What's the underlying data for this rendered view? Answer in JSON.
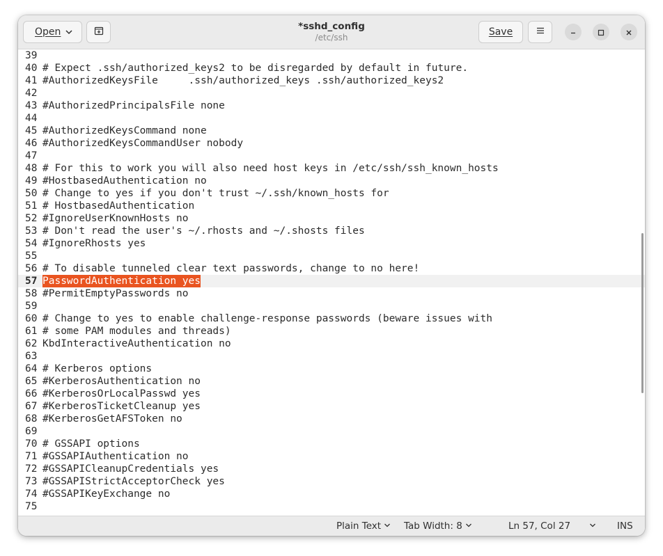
{
  "header": {
    "open_label": "Open",
    "save_label": "Save",
    "title": "*sshd_config",
    "subtitle": "/etc/ssh"
  },
  "editor": {
    "lines": [
      {
        "num": "39",
        "text": ""
      },
      {
        "num": "40",
        "text": "# Expect .ssh/authorized_keys2 to be disregarded by default in future."
      },
      {
        "num": "41",
        "text": "#AuthorizedKeysFile     .ssh/authorized_keys .ssh/authorized_keys2"
      },
      {
        "num": "42",
        "text": ""
      },
      {
        "num": "43",
        "text": "#AuthorizedPrincipalsFile none"
      },
      {
        "num": "44",
        "text": ""
      },
      {
        "num": "45",
        "text": "#AuthorizedKeysCommand none"
      },
      {
        "num": "46",
        "text": "#AuthorizedKeysCommandUser nobody"
      },
      {
        "num": "47",
        "text": ""
      },
      {
        "num": "48",
        "text": "# For this to work you will also need host keys in /etc/ssh/ssh_known_hosts"
      },
      {
        "num": "49",
        "text": "#HostbasedAuthentication no"
      },
      {
        "num": "50",
        "text": "# Change to yes if you don't trust ~/.ssh/known_hosts for"
      },
      {
        "num": "51",
        "text": "# HostbasedAuthentication"
      },
      {
        "num": "52",
        "text": "#IgnoreUserKnownHosts no"
      },
      {
        "num": "53",
        "text": "# Don't read the user's ~/.rhosts and ~/.shosts files"
      },
      {
        "num": "54",
        "text": "#IgnoreRhosts yes"
      },
      {
        "num": "55",
        "text": ""
      },
      {
        "num": "56",
        "text": "# To disable tunneled clear text passwords, change to no here!"
      },
      {
        "num": "57",
        "text": "PasswordAuthentication yes",
        "current": true,
        "selected": true
      },
      {
        "num": "58",
        "text": "#PermitEmptyPasswords no"
      },
      {
        "num": "59",
        "text": ""
      },
      {
        "num": "60",
        "text": "# Change to yes to enable challenge-response passwords (beware issues with"
      },
      {
        "num": "61",
        "text": "# some PAM modules and threads)"
      },
      {
        "num": "62",
        "text": "KbdInteractiveAuthentication no"
      },
      {
        "num": "63",
        "text": ""
      },
      {
        "num": "64",
        "text": "# Kerberos options"
      },
      {
        "num": "65",
        "text": "#KerberosAuthentication no"
      },
      {
        "num": "66",
        "text": "#KerberosOrLocalPasswd yes"
      },
      {
        "num": "67",
        "text": "#KerberosTicketCleanup yes"
      },
      {
        "num": "68",
        "text": "#KerberosGetAFSToken no"
      },
      {
        "num": "69",
        "text": ""
      },
      {
        "num": "70",
        "text": "# GSSAPI options"
      },
      {
        "num": "71",
        "text": "#GSSAPIAuthentication no"
      },
      {
        "num": "72",
        "text": "#GSSAPICleanupCredentials yes"
      },
      {
        "num": "73",
        "text": "#GSSAPIStrictAcceptorCheck yes"
      },
      {
        "num": "74",
        "text": "#GSSAPIKeyExchange no"
      },
      {
        "num": "75",
        "text": ""
      }
    ]
  },
  "statusbar": {
    "language": "Plain Text",
    "tab_width": "Tab Width: 8",
    "position": "Ln 57, Col 27",
    "mode": "INS"
  },
  "colors": {
    "selection": "#e95420",
    "current_line": "#f1f1f1",
    "headerbar": "#ebebeb"
  },
  "icons": [
    "chevron-down-icon",
    "new-tab-icon",
    "hamburger-menu-icon",
    "minimize-icon",
    "maximize-icon",
    "close-icon"
  ]
}
